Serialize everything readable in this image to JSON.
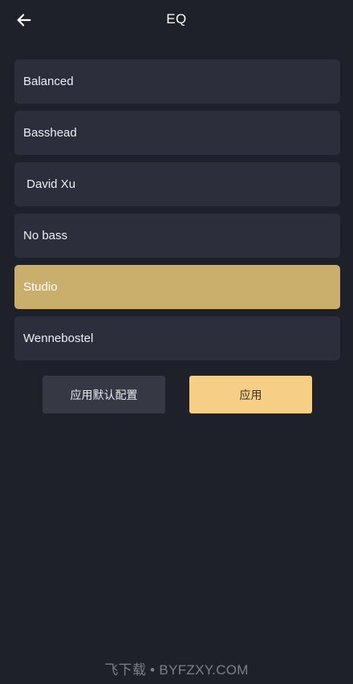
{
  "header": {
    "title": "EQ"
  },
  "presets": [
    {
      "label": "Balanced",
      "selected": false
    },
    {
      "label": "Basshead",
      "selected": false
    },
    {
      "label": " David Xu",
      "selected": false
    },
    {
      "label": "No bass",
      "selected": false
    },
    {
      "label": "Studio",
      "selected": true
    },
    {
      "label": "Wennebostel",
      "selected": false
    }
  ],
  "actions": {
    "apply_default_label": "应用默认配置",
    "apply_label": "应用"
  },
  "watermark": "飞下载 • BYFZXY.COM",
  "colors": {
    "background": "#1f212a",
    "item_background": "#2c2f3b",
    "selected_background": "#c9ae6c",
    "apply_button": "#f6ce86",
    "default_button": "#363944"
  },
  "icons": {
    "back": "arrow-left-icon"
  }
}
